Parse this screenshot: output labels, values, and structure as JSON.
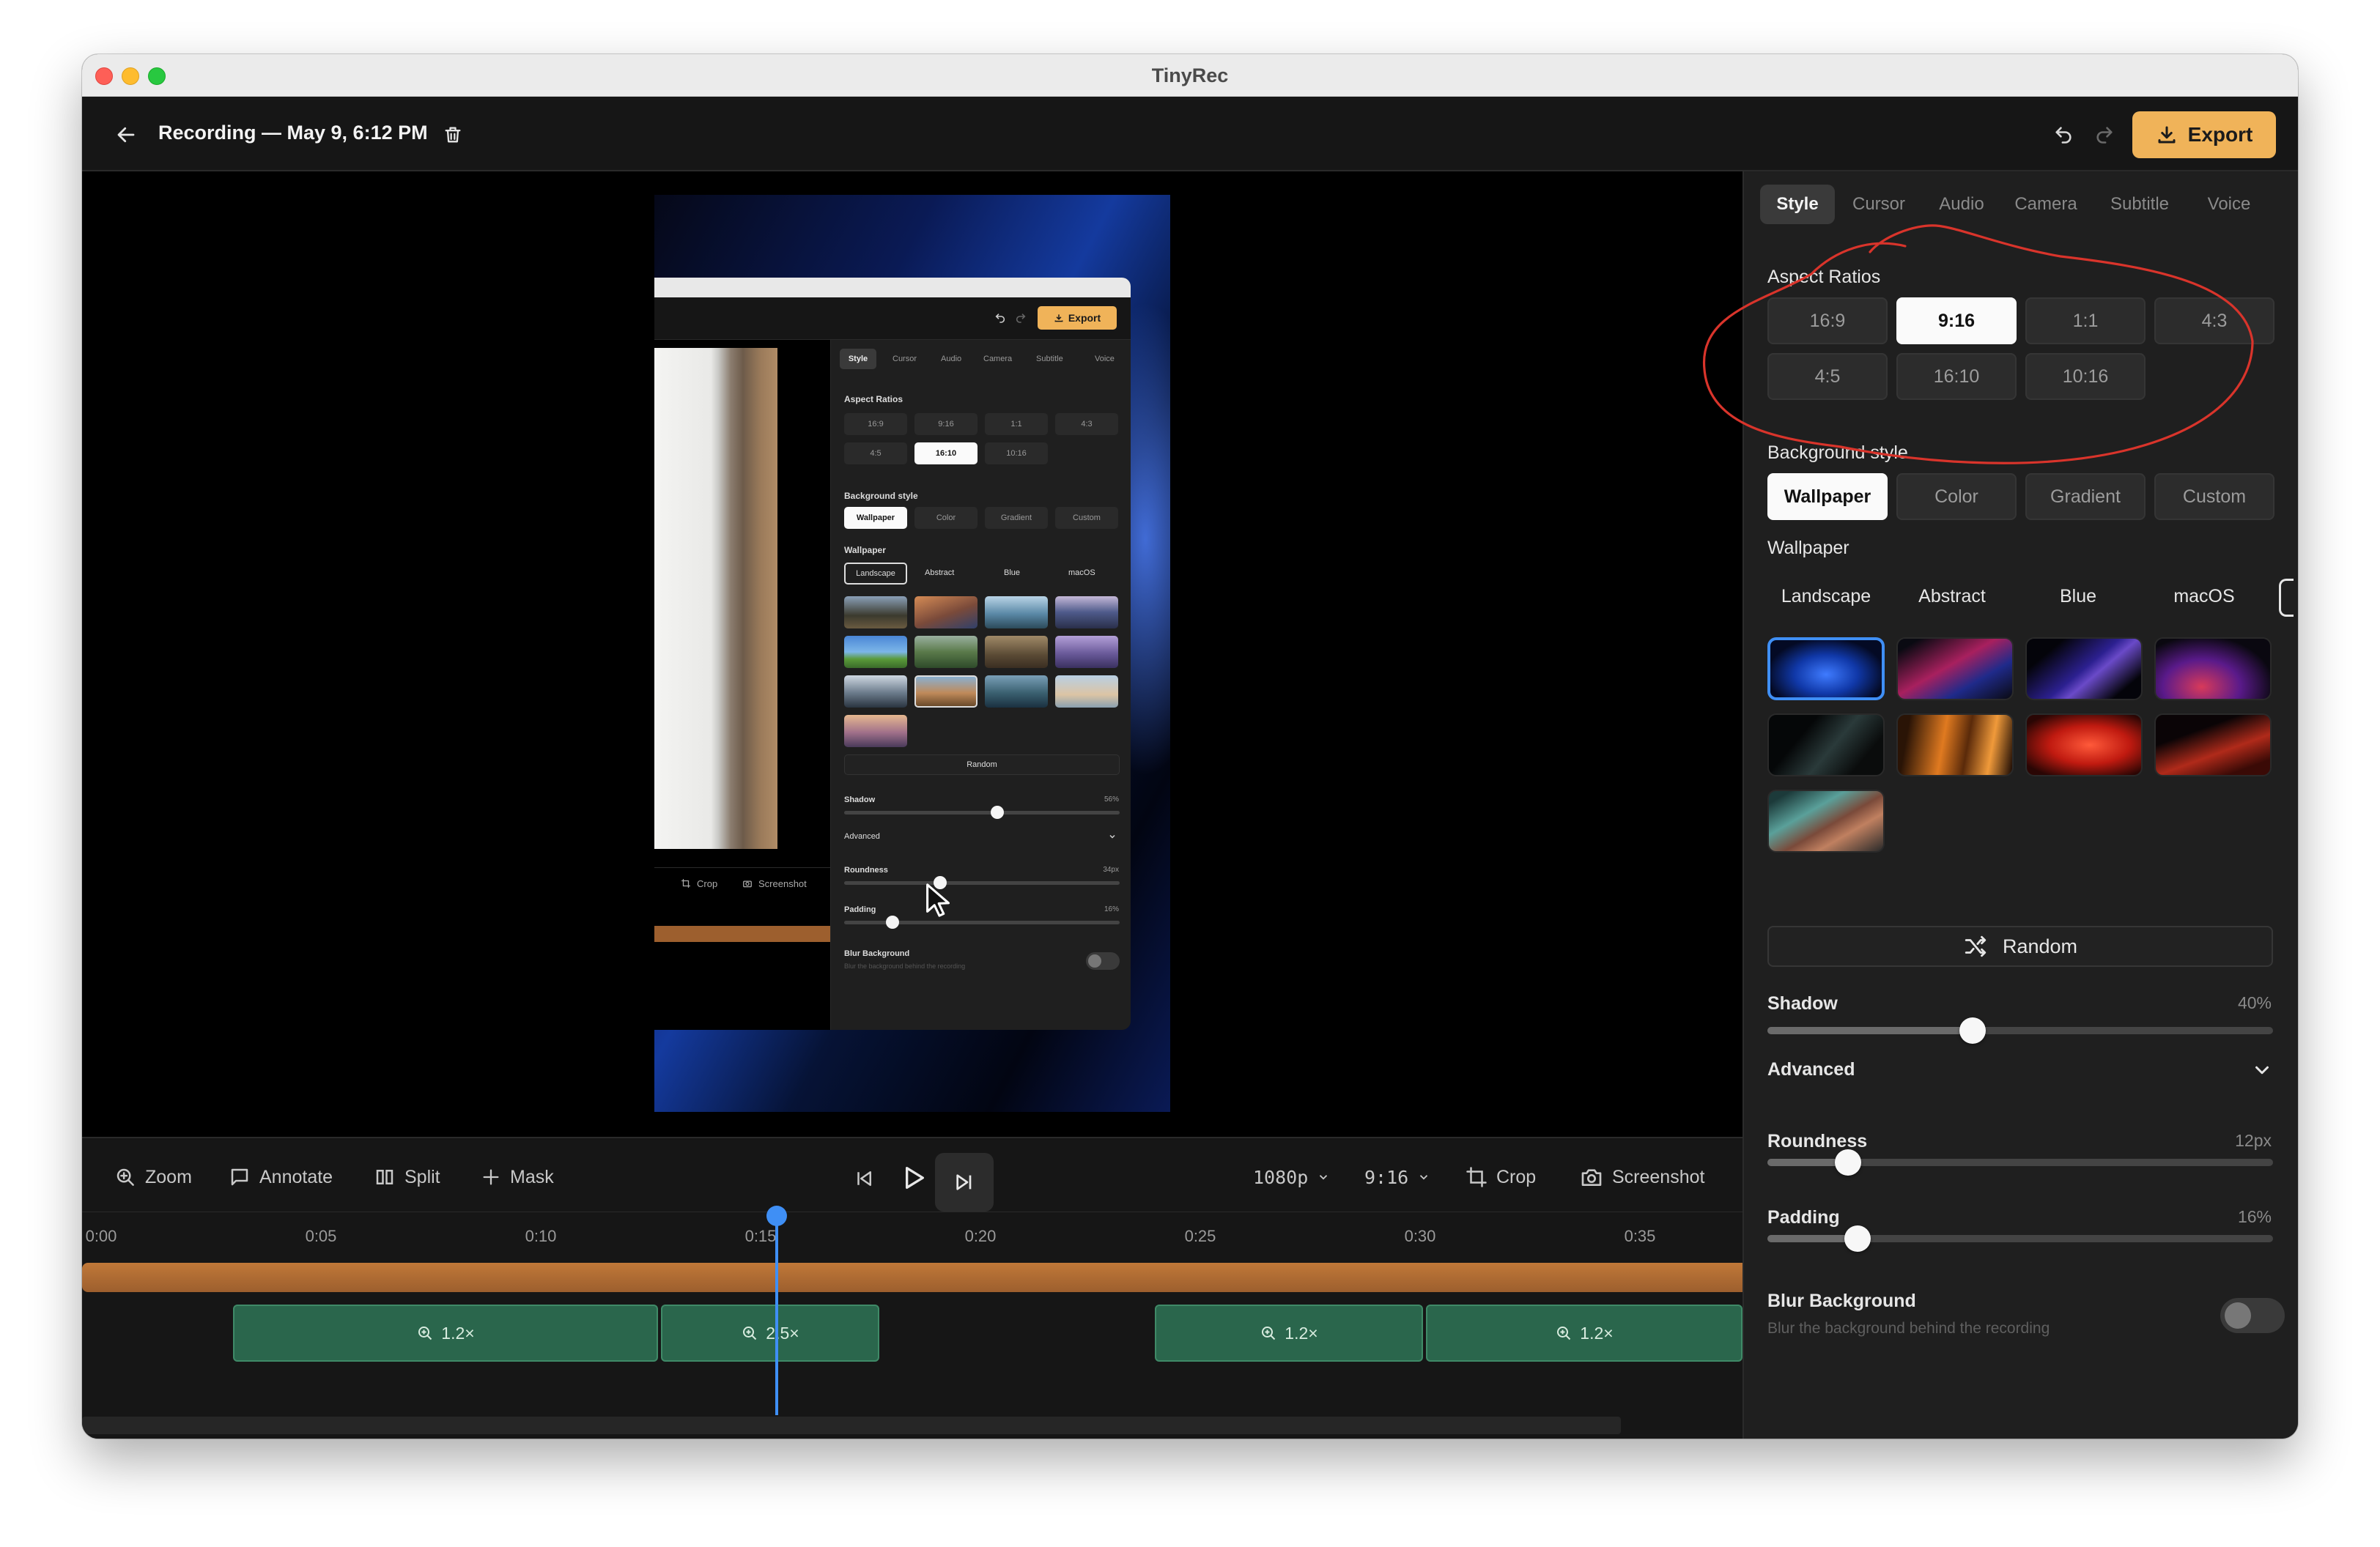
{
  "window": {
    "title": "TinyRec"
  },
  "header": {
    "recording_title": "Recording — May 9, 6:12 PM",
    "export_label": "Export"
  },
  "nested_preview": {
    "export_label": "Export",
    "tabs": [
      "Style",
      "Cursor",
      "Audio",
      "Camera",
      "Subtitle",
      "Voice"
    ],
    "aspect_title": "Aspect Ratios",
    "aspects": [
      "16:9",
      "9:16",
      "1:1",
      "4:3",
      "4:5",
      "16:10",
      "10:16"
    ],
    "bg_title": "Background style",
    "bg_styles": [
      "Wallpaper",
      "Color",
      "Gradient",
      "Custom"
    ],
    "wallpaper_title": "Wallpaper",
    "wallpaper_tabs": [
      "Landscape",
      "Abstract",
      "Blue",
      "macOS"
    ],
    "random_label": "Random",
    "shadow_label": "Shadow",
    "shadow_value": "56%",
    "advanced_label": "Advanced",
    "roundness_label": "Roundness",
    "roundness_value": "34px",
    "padding_label": "Padding",
    "padding_value": "16%",
    "blur_label": "Blur Background",
    "blur_desc": "Blur the background behind the recording",
    "toolbar_crop": "Crop",
    "toolbar_screenshot": "Screenshot"
  },
  "timeline": {
    "tools": [
      {
        "label": "Zoom",
        "icon": "zoom-in-icon"
      },
      {
        "label": "Annotate",
        "icon": "annotate-icon"
      },
      {
        "label": "Split",
        "icon": "split-icon"
      },
      {
        "label": "Mask",
        "icon": "plus-icon"
      }
    ],
    "resolution": "1080p",
    "aspect": "9:16",
    "crop_label": "Crop",
    "screenshot_label": "Screenshot",
    "ticks": [
      "0:00",
      "0:05",
      "0:10",
      "0:15",
      "0:20",
      "0:25",
      "0:30",
      "0:35"
    ],
    "zoom_clips": [
      "1.2×",
      "2.5×",
      "1.2×",
      "1.2×"
    ]
  },
  "panel": {
    "tabs": [
      "Style",
      "Cursor",
      "Audio",
      "Camera",
      "Subtitle",
      "Voice"
    ],
    "aspect_title": "Aspect Ratios",
    "aspects": [
      "16:9",
      "9:16",
      "1:1",
      "4:3",
      "4:5",
      "16:10",
      "10:16"
    ],
    "bg_title": "Background style",
    "bg_styles": [
      "Wallpaper",
      "Color",
      "Gradient",
      "Custom"
    ],
    "wallpaper_title": "Wallpaper",
    "wallpaper_tabs": [
      "Landscape",
      "Abstract",
      "Blue",
      "macOS"
    ],
    "random_label": "Random",
    "shadow_label": "Shadow",
    "shadow_value": "40%",
    "advanced_label": "Advanced",
    "roundness_label": "Roundness",
    "roundness_value": "12px",
    "padding_label": "Padding",
    "padding_value": "16%",
    "blur_label": "Blur Background",
    "blur_desc": "Blur the background behind the recording"
  },
  "levels": {
    "shadow": 0.4,
    "roundness": 0.14,
    "padding": 0.16,
    "nested_shadow": 0.56,
    "nested_roundness": 0.34,
    "nested_padding": 0.16
  },
  "colors": {
    "accent": "#f0b359",
    "selection": "#3f8ff5",
    "annotation": "#d9342b",
    "zoom_clip": "#2a664c",
    "audio_track": "#9d5f2e"
  }
}
